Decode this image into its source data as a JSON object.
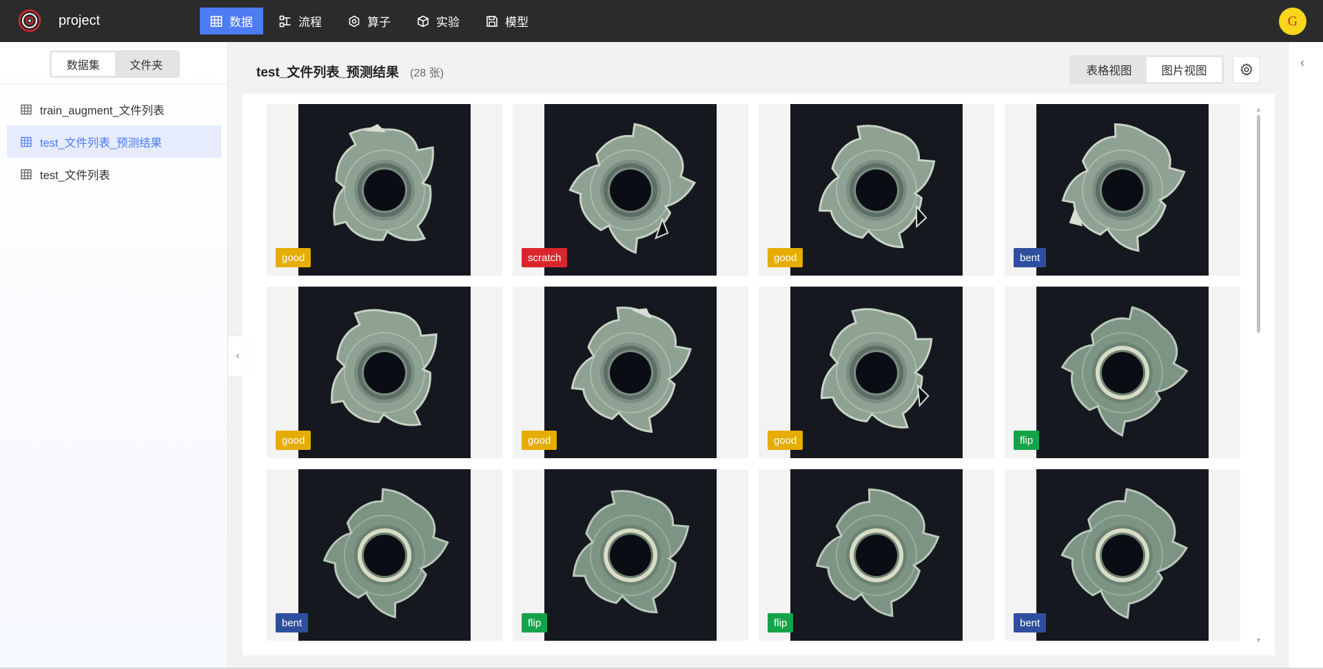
{
  "app": {
    "project_name": "project",
    "avatar_letter": "G"
  },
  "nav": [
    {
      "label": "数据",
      "icon": "table-icon",
      "active": true
    },
    {
      "label": "流程",
      "icon": "flow-icon",
      "active": false
    },
    {
      "label": "算子",
      "icon": "hexagon-icon",
      "active": false
    },
    {
      "label": "实验",
      "icon": "cube-icon",
      "active": false
    },
    {
      "label": "模型",
      "icon": "save-icon",
      "active": false
    }
  ],
  "sidebar": {
    "segment": {
      "datasets": "数据集",
      "folders": "文件夹",
      "active": "datasets"
    },
    "items": [
      {
        "label": "train_augment_文件列表",
        "active": false
      },
      {
        "label": "test_文件列表_预测结果",
        "active": true
      },
      {
        "label": "test_文件列表",
        "active": false
      }
    ]
  },
  "main": {
    "title": "test_文件列表_预测结果",
    "count": "(28 张)",
    "views": {
      "table": "表格视图",
      "image": "图片视图",
      "active": "image"
    }
  },
  "label_colors": {
    "good": "#e6ac00",
    "scratch": "#d9262c",
    "bent": "#2e4f9e",
    "flip": "#15a34a"
  },
  "gallery": [
    {
      "label": "good",
      "defect": "chip-top"
    },
    {
      "label": "scratch",
      "defect": "chip-right"
    },
    {
      "label": "good",
      "defect": "chip-right"
    },
    {
      "label": "bent",
      "defect": "chip-bottomleft"
    },
    {
      "label": "good",
      "defect": "none"
    },
    {
      "label": "good",
      "defect": "chip-top"
    },
    {
      "label": "good",
      "defect": "chip-right"
    },
    {
      "label": "flip",
      "defect": "flip"
    },
    {
      "label": "bent",
      "defect": "flip"
    },
    {
      "label": "flip",
      "defect": "flip"
    },
    {
      "label": "flip",
      "defect": "flip"
    },
    {
      "label": "bent",
      "defect": "flip"
    }
  ]
}
